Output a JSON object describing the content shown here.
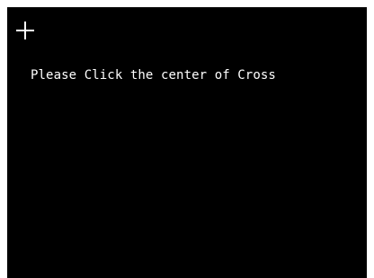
{
  "calibration": {
    "instruction": "Please Click the center of Cross",
    "cross_icon": "crosshair-plus-icon",
    "background_color": "#000000",
    "foreground_color": "#ffffff"
  }
}
